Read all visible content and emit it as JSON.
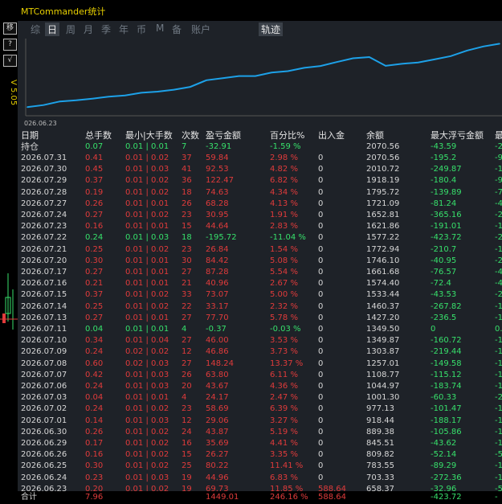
{
  "app_title": "MTCommander统计",
  "version": "V 5.05",
  "sidebar_buttons": [
    "移",
    "?",
    "√"
  ],
  "tabs": [
    {
      "label": "综",
      "active": false
    },
    {
      "label": "日",
      "active": true
    },
    {
      "label": "周",
      "active": false
    },
    {
      "label": "月",
      "active": false
    },
    {
      "label": "季",
      "active": false
    },
    {
      "label": "年",
      "active": false
    },
    {
      "label": "币",
      "active": false
    },
    {
      "label": "M",
      "active": false
    },
    {
      "label": "备",
      "active": false
    },
    {
      "label": "账户",
      "active": false
    },
    {
      "label": "轨迹",
      "active": true
    }
  ],
  "colors": {
    "bg": "#1e2228",
    "line": "#1da1e8",
    "up": "#e03b3b",
    "down": "#37e06b",
    "title": "#e8d000"
  },
  "chart_data": {
    "type": "line",
    "xlabel_start": "026.06.23",
    "x": [
      "2026.06.23",
      "2026.06.24",
      "2026.06.25",
      "2026.06.26",
      "2026.06.29",
      "2026.06.30",
      "2026.07.01",
      "2026.07.02",
      "2026.07.03",
      "2026.07.06",
      "2026.07.07",
      "2026.07.08",
      "2026.07.09",
      "2026.07.10",
      "2026.07.11",
      "2026.07.13",
      "2026.07.14",
      "2026.07.15",
      "2026.07.16",
      "2026.07.17",
      "2026.07.20",
      "2026.07.21",
      "2026.07.22",
      "2026.07.23",
      "2026.07.24",
      "2026.07.27",
      "2026.07.28",
      "2026.07.29",
      "2026.07.30",
      "2026.07.31"
    ],
    "values": [
      658.37,
      703.33,
      783.55,
      809.82,
      845.51,
      889.38,
      918.44,
      977.13,
      1001.3,
      1044.97,
      1108.77,
      1257.01,
      1303.87,
      1349.87,
      1349.5,
      1427.2,
      1460.37,
      1533.44,
      1574.4,
      1661.68,
      1746.1,
      1772.94,
      1577.22,
      1621.86,
      1652.81,
      1721.09,
      1795.72,
      1918.19,
      2010.72,
      2070.56
    ],
    "ylim": [
      500,
      2150
    ]
  },
  "headers": [
    "日期",
    "总手数",
    "最小|大手数",
    "次数",
    "盈亏金额",
    "百分比%",
    "出入金",
    "余额",
    "最大浮亏金额",
    "最"
  ],
  "holding": {
    "date": "持仓",
    "lots": "0.07",
    "minmax": "0.01 | 0.01",
    "count": "7",
    "pnl": "-32.91",
    "pct": "-1.59 %",
    "flow": "",
    "balance": "2070.56",
    "maxdd": "-43.59",
    "extra": "-2"
  },
  "rows": [
    {
      "date": "2026.07.31",
      "lots": "0.41",
      "minmax": "0.01 | 0.02",
      "count": "37",
      "pnl": "59.84",
      "pct": "2.98 %",
      "flow": "0",
      "balance": "2070.56",
      "maxdd": "-195.2",
      "extra": "-9",
      "dir": "up"
    },
    {
      "date": "2026.07.30",
      "lots": "0.45",
      "minmax": "0.01 | 0.03",
      "count": "41",
      "pnl": "92.53",
      "pct": "4.82 %",
      "flow": "0",
      "balance": "2010.72",
      "maxdd": "-249.87",
      "extra": "-1",
      "dir": "up"
    },
    {
      "date": "2026.07.29",
      "lots": "0.37",
      "minmax": "0.01 | 0.02",
      "count": "36",
      "pnl": "122.47",
      "pct": "6.82 %",
      "flow": "0",
      "balance": "1918.19",
      "maxdd": "-180.4",
      "extra": "-9",
      "dir": "up"
    },
    {
      "date": "2026.07.28",
      "lots": "0.19",
      "minmax": "0.01 | 0.02",
      "count": "18",
      "pnl": "74.63",
      "pct": "4.34 %",
      "flow": "0",
      "balance": "1795.72",
      "maxdd": "-139.89",
      "extra": "-7",
      "dir": "up"
    },
    {
      "date": "2026.07.27",
      "lots": "0.26",
      "minmax": "0.01 | 0.01",
      "count": "26",
      "pnl": "68.28",
      "pct": "4.13 %",
      "flow": "0",
      "balance": "1721.09",
      "maxdd": "-81.24",
      "extra": "-4",
      "dir": "up"
    },
    {
      "date": "2026.07.24",
      "lots": "0.27",
      "minmax": "0.01 | 0.02",
      "count": "23",
      "pnl": "30.95",
      "pct": "1.91 %",
      "flow": "0",
      "balance": "1652.81",
      "maxdd": "-365.16",
      "extra": "-2",
      "dir": "up"
    },
    {
      "date": "2026.07.23",
      "lots": "0.16",
      "minmax": "0.01 | 0.01",
      "count": "15",
      "pnl": "44.64",
      "pct": "2.83 %",
      "flow": "0",
      "balance": "1621.86",
      "maxdd": "-191.01",
      "extra": "-1",
      "dir": "up"
    },
    {
      "date": "2026.07.22",
      "lots": "0.24",
      "minmax": "0.01 | 0.03",
      "count": "18",
      "pnl": "-195.72",
      "pct": "-11.04 %",
      "flow": "0",
      "balance": "1577.22",
      "maxdd": "-423.72",
      "extra": "-2",
      "dir": "down"
    },
    {
      "date": "2026.07.21",
      "lots": "0.25",
      "minmax": "0.01 | 0.02",
      "count": "23",
      "pnl": "26.84",
      "pct": "1.54 %",
      "flow": "0",
      "balance": "1772.94",
      "maxdd": "-210.7",
      "extra": "-1",
      "dir": "up"
    },
    {
      "date": "2026.07.20",
      "lots": "0.30",
      "minmax": "0.01 | 0.01",
      "count": "30",
      "pnl": "84.42",
      "pct": "5.08 %",
      "flow": "0",
      "balance": "1746.10",
      "maxdd": "-40.95",
      "extra": "-2",
      "dir": "up"
    },
    {
      "date": "2026.07.17",
      "lots": "0.27",
      "minmax": "0.01 | 0.01",
      "count": "27",
      "pnl": "87.28",
      "pct": "5.54 %",
      "flow": "0",
      "balance": "1661.68",
      "maxdd": "-76.57",
      "extra": "-4",
      "dir": "up"
    },
    {
      "date": "2026.07.16",
      "lots": "0.21",
      "minmax": "0.01 | 0.01",
      "count": "21",
      "pnl": "40.96",
      "pct": "2.67 %",
      "flow": "0",
      "balance": "1574.40",
      "maxdd": "-72.4",
      "extra": "-4",
      "dir": "up"
    },
    {
      "date": "2026.07.15",
      "lots": "0.37",
      "minmax": "0.01 | 0.02",
      "count": "33",
      "pnl": "73.07",
      "pct": "5.00 %",
      "flow": "0",
      "balance": "1533.44",
      "maxdd": "-43.53",
      "extra": "-2",
      "dir": "up"
    },
    {
      "date": "2026.07.14",
      "lots": "0.25",
      "minmax": "0.01 | 0.02",
      "count": "22",
      "pnl": "33.17",
      "pct": "2.32 %",
      "flow": "0",
      "balance": "1460.37",
      "maxdd": "-267.82",
      "extra": "-1",
      "dir": "up"
    },
    {
      "date": "2026.07.13",
      "lots": "0.27",
      "minmax": "0.01 | 0.01",
      "count": "27",
      "pnl": "77.70",
      "pct": "5.78 %",
      "flow": "0",
      "balance": "1427.20",
      "maxdd": "-236.5",
      "extra": "-1",
      "dir": "up"
    },
    {
      "date": "2026.07.11",
      "lots": "0.04",
      "minmax": "0.01 | 0.01",
      "count": "4",
      "pnl": "-0.37",
      "pct": "-0.03 %",
      "flow": "0",
      "balance": "1349.50",
      "maxdd": "0",
      "extra": "0.",
      "dir": "down"
    },
    {
      "date": "2026.07.10",
      "lots": "0.34",
      "minmax": "0.01 | 0.04",
      "count": "27",
      "pnl": "46.00",
      "pct": "3.53 %",
      "flow": "0",
      "balance": "1349.87",
      "maxdd": "-160.72",
      "extra": "-1",
      "dir": "up"
    },
    {
      "date": "2026.07.09",
      "lots": "0.24",
      "minmax": "0.02 | 0.02",
      "count": "12",
      "pnl": "46.86",
      "pct": "3.73 %",
      "flow": "0",
      "balance": "1303.87",
      "maxdd": "-219.44",
      "extra": "-1",
      "dir": "up"
    },
    {
      "date": "2026.07.08",
      "lots": "0.60",
      "minmax": "0.02 | 0.03",
      "count": "27",
      "pnl": "148.24",
      "pct": "13.37 %",
      "flow": "0",
      "balance": "1257.01",
      "maxdd": "-149.58",
      "extra": "-1",
      "dir": "up"
    },
    {
      "date": "2026.07.07",
      "lots": "0.42",
      "minmax": "0.01 | 0.03",
      "count": "26",
      "pnl": "63.80",
      "pct": "6.11 %",
      "flow": "0",
      "balance": "1108.77",
      "maxdd": "-115.12",
      "extra": "-1",
      "dir": "up"
    },
    {
      "date": "2026.07.06",
      "lots": "0.24",
      "minmax": "0.01 | 0.03",
      "count": "20",
      "pnl": "43.67",
      "pct": "4.36 %",
      "flow": "0",
      "balance": "1044.97",
      "maxdd": "-183.74",
      "extra": "-1",
      "dir": "up"
    },
    {
      "date": "2026.07.03",
      "lots": "0.04",
      "minmax": "0.01 | 0.01",
      "count": "4",
      "pnl": "24.17",
      "pct": "2.47 %",
      "flow": "0",
      "balance": "1001.30",
      "maxdd": "-60.33",
      "extra": "-2",
      "dir": "up"
    },
    {
      "date": "2026.07.02",
      "lots": "0.24",
      "minmax": "0.01 | 0.02",
      "count": "23",
      "pnl": "58.69",
      "pct": "6.39 %",
      "flow": "0",
      "balance": "977.13",
      "maxdd": "-101.47",
      "extra": "-1",
      "dir": "up"
    },
    {
      "date": "2026.07.01",
      "lots": "0.14",
      "minmax": "0.01 | 0.03",
      "count": "12",
      "pnl": "29.06",
      "pct": "3.27 %",
      "flow": "0",
      "balance": "918.44",
      "maxdd": "-188.17",
      "extra": "-1",
      "dir": "up"
    },
    {
      "date": "2026.06.30",
      "lots": "0.26",
      "minmax": "0.01 | 0.02",
      "count": "24",
      "pnl": "43.87",
      "pct": "5.19 %",
      "flow": "0",
      "balance": "889.38",
      "maxdd": "-105.86",
      "extra": "-1",
      "dir": "up"
    },
    {
      "date": "2026.06.29",
      "lots": "0.17",
      "minmax": "0.01 | 0.02",
      "count": "16",
      "pnl": "35.69",
      "pct": "4.41 %",
      "flow": "0",
      "balance": "845.51",
      "maxdd": "-43.62",
      "extra": "-1",
      "dir": "up"
    },
    {
      "date": "2026.06.26",
      "lots": "0.16",
      "minmax": "0.01 | 0.02",
      "count": "15",
      "pnl": "26.27",
      "pct": "3.35 %",
      "flow": "0",
      "balance": "809.82",
      "maxdd": "-52.14",
      "extra": "-5",
      "dir": "up"
    },
    {
      "date": "2026.06.25",
      "lots": "0.30",
      "minmax": "0.01 | 0.02",
      "count": "25",
      "pnl": "80.22",
      "pct": "11.41 %",
      "flow": "0",
      "balance": "783.55",
      "maxdd": "-89.29",
      "extra": "-1",
      "dir": "up"
    },
    {
      "date": "2026.06.24",
      "lots": "0.23",
      "minmax": "0.01 | 0.03",
      "count": "19",
      "pnl": "44.96",
      "pct": "6.83 %",
      "flow": "0",
      "balance": "703.33",
      "maxdd": "-272.36",
      "extra": "-1",
      "dir": "up"
    },
    {
      "date": "2026.06.23",
      "lots": "0.20",
      "minmax": "0.01 | 0.02",
      "count": "19",
      "pnl": "69.73",
      "pct": "11.85 %",
      "flow": "588.64",
      "balance": "658.37",
      "maxdd": "-32.96",
      "extra": "-5",
      "dir": "up"
    }
  ],
  "footer": {
    "label": "合计",
    "lots": "7.96",
    "pnl": "1449.01",
    "pct": "246.16 %",
    "flow": "588.64",
    "maxdd": "-423.72",
    "extra": "-"
  }
}
